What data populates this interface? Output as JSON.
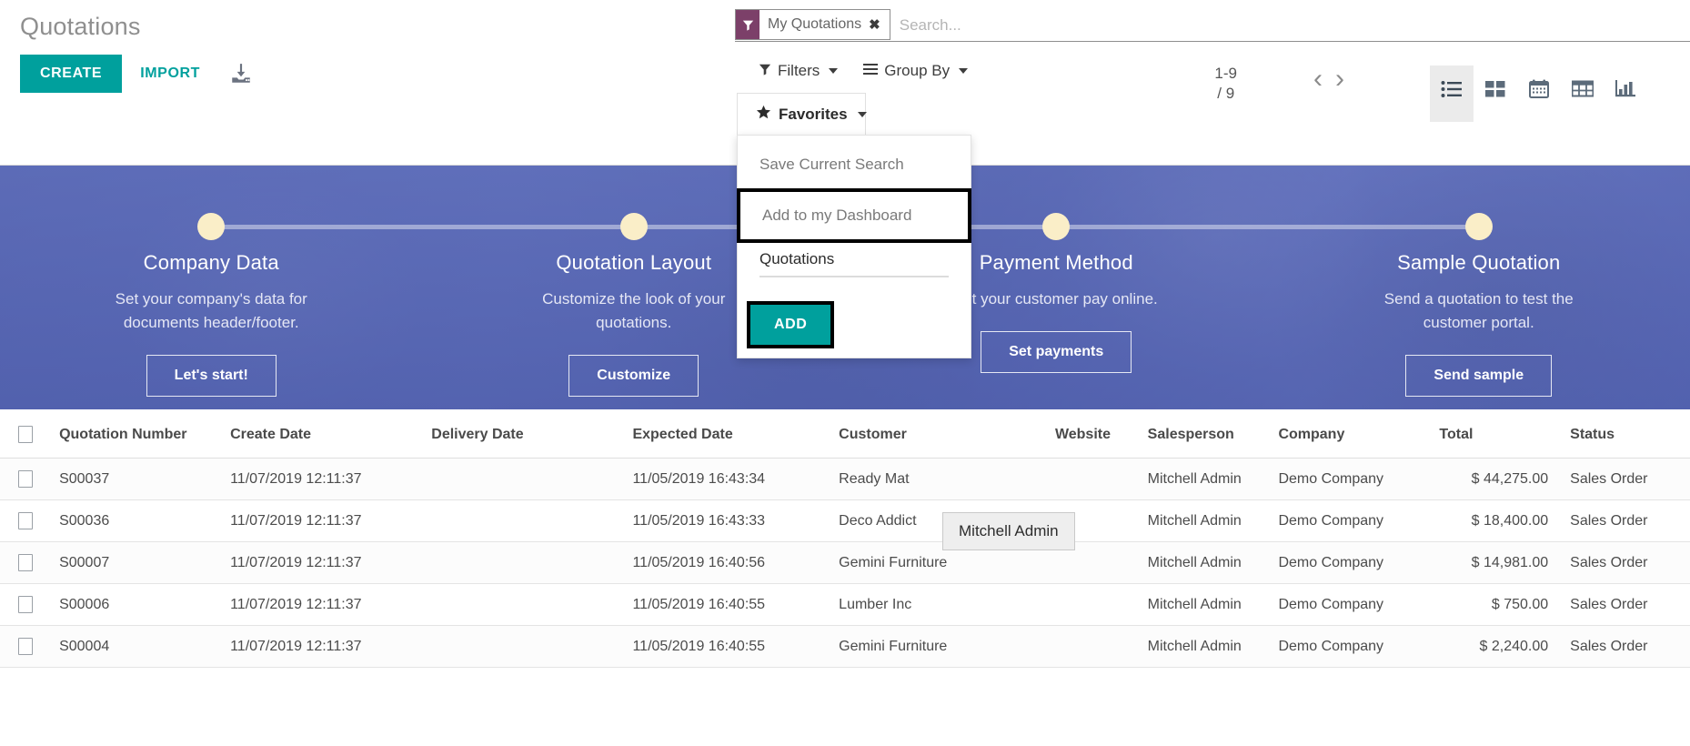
{
  "header": {
    "title": "Quotations",
    "create_label": "CREATE",
    "import_label": "IMPORT",
    "download_icon": "download-icon"
  },
  "search": {
    "facet_label": "My Quotations",
    "facet_icon": "filter-icon",
    "facet_remove": "✖",
    "placeholder": "Search...",
    "value": "",
    "facet_icon_color": "#7c4069"
  },
  "toolbar": {
    "filters_label": "Filters",
    "group_by_label": "Group By",
    "favorites_label": "Favorites",
    "filters_icon": "filter-icon",
    "group_by_icon": "hamburger-icon",
    "favorites_icon": "star-icon"
  },
  "favorites_menu": {
    "save_current_search": "Save Current Search",
    "add_to_dashboard": "Add to my Dashboard",
    "name_input_value": "Quotations",
    "add_label": "ADD",
    "highlight_color": "#000000"
  },
  "pager": {
    "range": "1-9",
    "total": "/ 9",
    "prev_icon": "chevron-left-icon",
    "next_icon": "chevron-right-icon"
  },
  "views": [
    {
      "name": "list",
      "icon": "list-icon",
      "active": true
    },
    {
      "name": "kanban",
      "icon": "kanban-icon",
      "active": false
    },
    {
      "name": "calendar",
      "icon": "calendar-icon",
      "active": false
    },
    {
      "name": "pivot",
      "icon": "pivot-table-icon",
      "active": false
    },
    {
      "name": "graph",
      "icon": "bar-chart-icon",
      "active": false
    }
  ],
  "banner": {
    "steps": [
      {
        "title": "Company Data",
        "desc": "Set your company's data for documents header/footer.",
        "button": "Let's start!"
      },
      {
        "title": "Quotation Layout",
        "desc": "Customize the look of your quotations.",
        "button": "Customize"
      },
      {
        "title": "Payment Method",
        "desc": "Let your customer pay online.",
        "button": "Set payments"
      },
      {
        "title": "Sample Quotation",
        "desc": "Send a quotation to test the customer portal.",
        "button": "Send sample"
      }
    ]
  },
  "table": {
    "columns": [
      "Quotation Number",
      "Create Date",
      "Delivery Date",
      "Expected Date",
      "Customer",
      "Website",
      "Salesperson",
      "Company",
      "Total",
      "Status"
    ],
    "rows": [
      {
        "quotation_number": "S00037",
        "create_date": "11/07/2019 12:11:37",
        "delivery_date": "",
        "expected_date": "11/05/2019 16:43:34",
        "customer": "Ready Mat",
        "website": "",
        "salesperson": "Mitchell Admin",
        "company": "Demo Company",
        "total": "$ 44,275.00",
        "status": "Sales Order"
      },
      {
        "quotation_number": "S00036",
        "create_date": "11/07/2019 12:11:37",
        "delivery_date": "",
        "expected_date": "11/05/2019 16:43:33",
        "customer": "Deco Addict",
        "website": "",
        "salesperson": "Mitchell Admin",
        "company": "Demo Company",
        "total": "$ 18,400.00",
        "status": "Sales Order"
      },
      {
        "quotation_number": "S00007",
        "create_date": "11/07/2019 12:11:37",
        "delivery_date": "",
        "expected_date": "11/05/2019 16:40:56",
        "customer": "Gemini Furniture",
        "website": "",
        "salesperson": "Mitchell Admin",
        "company": "Demo Company",
        "total": "$ 14,981.00",
        "status": "Sales Order"
      },
      {
        "quotation_number": "S00006",
        "create_date": "11/07/2019 12:11:37",
        "delivery_date": "",
        "expected_date": "11/05/2019 16:40:55",
        "customer": "Lumber Inc",
        "website": "",
        "salesperson": "Mitchell Admin",
        "company": "Demo Company",
        "total": "$ 750.00",
        "status": "Sales Order"
      },
      {
        "quotation_number": "S00004",
        "create_date": "11/07/2019 12:11:37",
        "delivery_date": "",
        "expected_date": "11/05/2019 16:40:55",
        "customer": "Gemini Furniture",
        "website": "",
        "salesperson": "Mitchell Admin",
        "company": "Demo Company",
        "total": "$ 2,240.00",
        "status": "Sales Order"
      }
    ]
  },
  "tooltip": {
    "text": "Mitchell Admin"
  },
  "colors": {
    "accent": "#00a09d",
    "facet": "#7c4069",
    "banner": "#5a6bb8"
  }
}
